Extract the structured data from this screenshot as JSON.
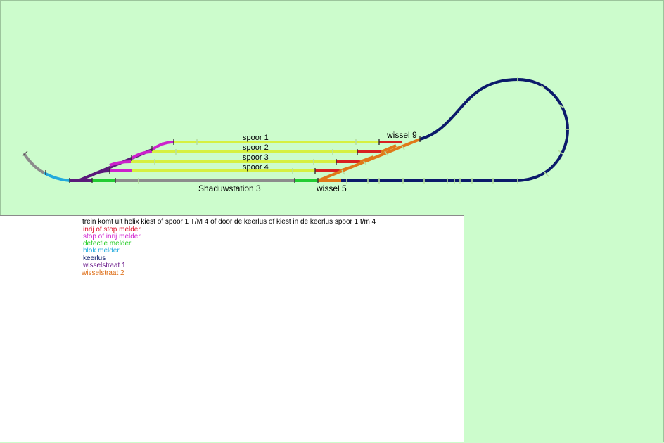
{
  "labels": {
    "spoor_1": "spoor 1",
    "spoor_2": "spoor 2",
    "spoor_3": "spoor 3",
    "spoor_4": "spoor 4",
    "shaduwstation": "Shaduwstation 3",
    "wissel_9": "wissel 9",
    "wissel_5": "wissel 5"
  },
  "legend": {
    "intro": "trein komt uit helix kiest of spoor 1 T/M 4 of door de keerlus of kiest in de keerlus spoor 1 t/m 4",
    "items": [
      {
        "label": "inrij of stop melder",
        "color": "#e0102a"
      },
      {
        "label": "stop of inrij melder",
        "color": "#d020d0"
      },
      {
        "label": "detectie melder",
        "color": "#22cc22"
      },
      {
        "label": "blok melder",
        "color": "#22aadd"
      },
      {
        "label": "keerlus",
        "color": "#0a1a6a"
      },
      {
        "label": "wisselstraat 1",
        "color": "#6a1a8a"
      },
      {
        "label": "wisselstraat 2",
        "color": "#dd6a10"
      }
    ]
  },
  "colors": {
    "background": "#ccfccc",
    "siding": "#d6f040",
    "stop_melder": "#d82020",
    "inrij_melder": "#cc22cc",
    "detectie": "#22cc33",
    "blok": "#22aadd",
    "keerlus": "#0b1a6b",
    "wisselstraat_1": "#5a1a7a",
    "wisselstraat_2": "#e07818",
    "grey_track": "#8c8c8c"
  }
}
